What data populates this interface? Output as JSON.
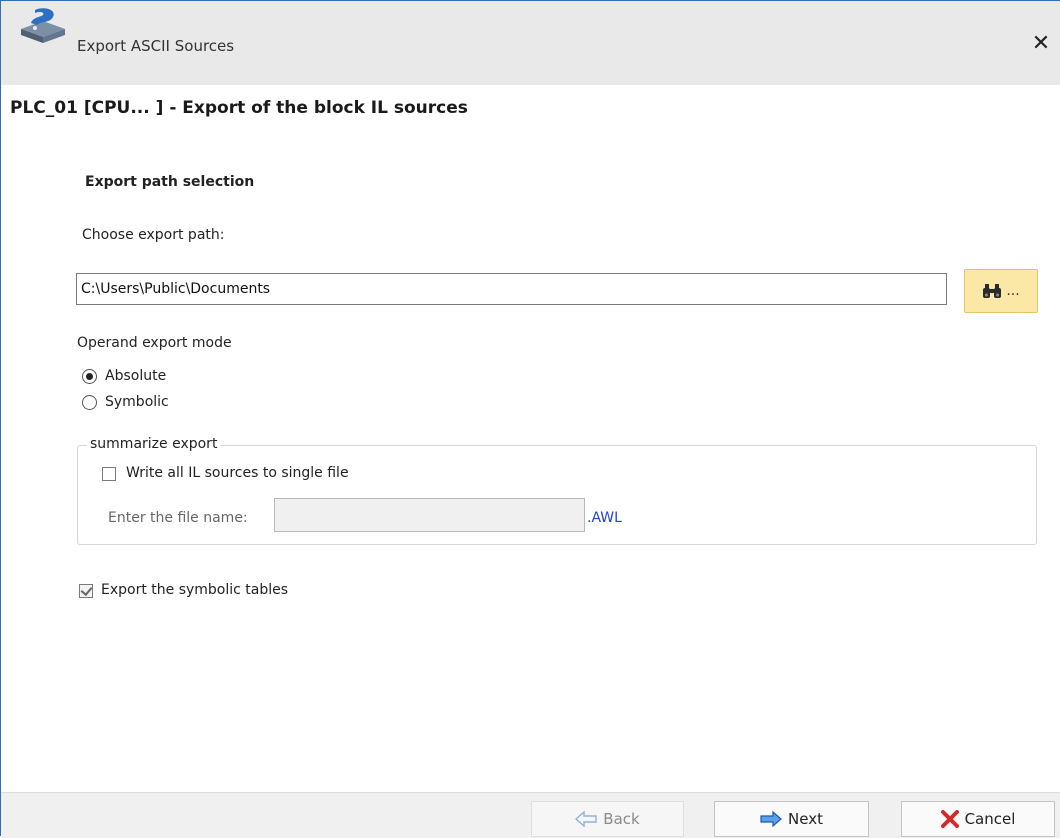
{
  "window": {
    "title": "Export ASCII Sources",
    "close_glyph": "✕",
    "icon": "app-drive-icon"
  },
  "header": {
    "title": "PLC_01 [CPU... ]  - Export of the block IL sources"
  },
  "export_path": {
    "section_title": "Export path selection",
    "choose_label": "Choose export path:",
    "path_value": "C:\\Users\\Public\\Documents",
    "browse_label": "...",
    "browse_icon": "binoculars-icon"
  },
  "operand_mode": {
    "label": "Operand export mode",
    "options": [
      {
        "label": "Absolute",
        "checked": true
      },
      {
        "label": "Symbolic",
        "checked": false
      }
    ]
  },
  "summarize": {
    "legend": "summarize export",
    "single_file_label": "Write all IL sources to single file",
    "single_file_checked": false,
    "file_name_label": "Enter the file name:",
    "file_name_value": "",
    "extension": ".AWL"
  },
  "symbolic_tables": {
    "label": "Export the symbolic tables",
    "checked": true
  },
  "footer": {
    "back_label": "Back",
    "next_label": "Next",
    "cancel_label": "Cancel"
  },
  "colors": {
    "accent_blue": "#2f6fb5",
    "browse_button_bg": "#fbe8a6",
    "extension_text": "#1f3fd8",
    "cancel_icon": "#d22a2a"
  }
}
